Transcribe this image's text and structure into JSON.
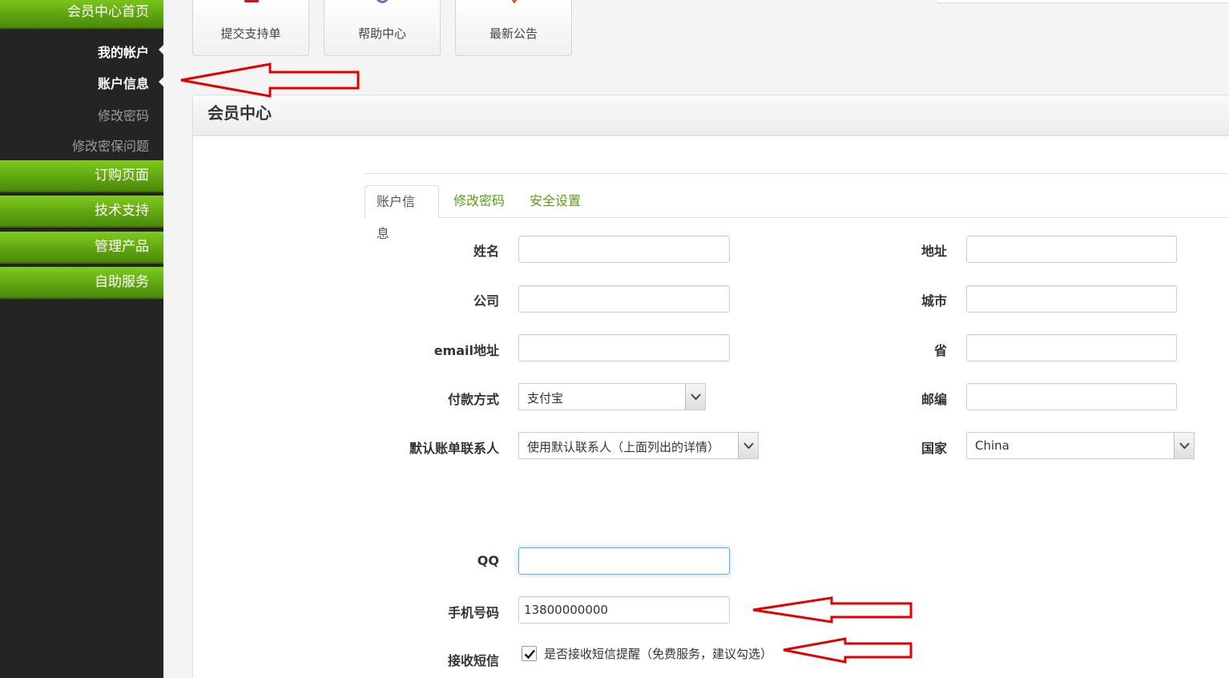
{
  "sidebar": {
    "home": "会员中心首页",
    "my_account": "我的帐户",
    "account_info": "账户信息",
    "change_password": "修改密码",
    "change_security_question": "修改密保问题",
    "order_page": "订购页面",
    "tech_support": "技术支持",
    "manage_products": "管理产品",
    "self_service": "自助服务"
  },
  "shortcuts": {
    "submit_ticket": "提交支持单",
    "help_center": "帮助中心",
    "latest_announcement": "最新公告"
  },
  "panel": {
    "title": "会员中心"
  },
  "tabs": [
    {
      "label": "账户信息",
      "active": true
    },
    {
      "label": "修改密码",
      "active": false
    },
    {
      "label": "安全设置",
      "active": false
    }
  ],
  "form": {
    "name_label": "姓名",
    "company_label": "公司",
    "email_label": "email地址",
    "payment_label": "付款方式",
    "payment_value": "支付宝",
    "billing_contact_label": "默认账单联系人",
    "billing_contact_value": "使用默认联系人（上面列出的详情）",
    "address_label": "地址",
    "city_label": "城市",
    "province_label": "省",
    "zip_label": "邮编",
    "country_label": "国家",
    "country_value": "China",
    "qq_label": "QQ",
    "phone_label": "手机号码",
    "phone_value": "13800000000",
    "sms_label": "接收短信",
    "sms_checked": true,
    "sms_checkbox_text": "是否接收短信提醒（免费服务，建议勾选）"
  },
  "colors": {
    "sidebar_bg": "#232323",
    "nav_green": "#6ab516",
    "tab_link_green": "#5a9e14",
    "annotation_red": "#e00000"
  }
}
